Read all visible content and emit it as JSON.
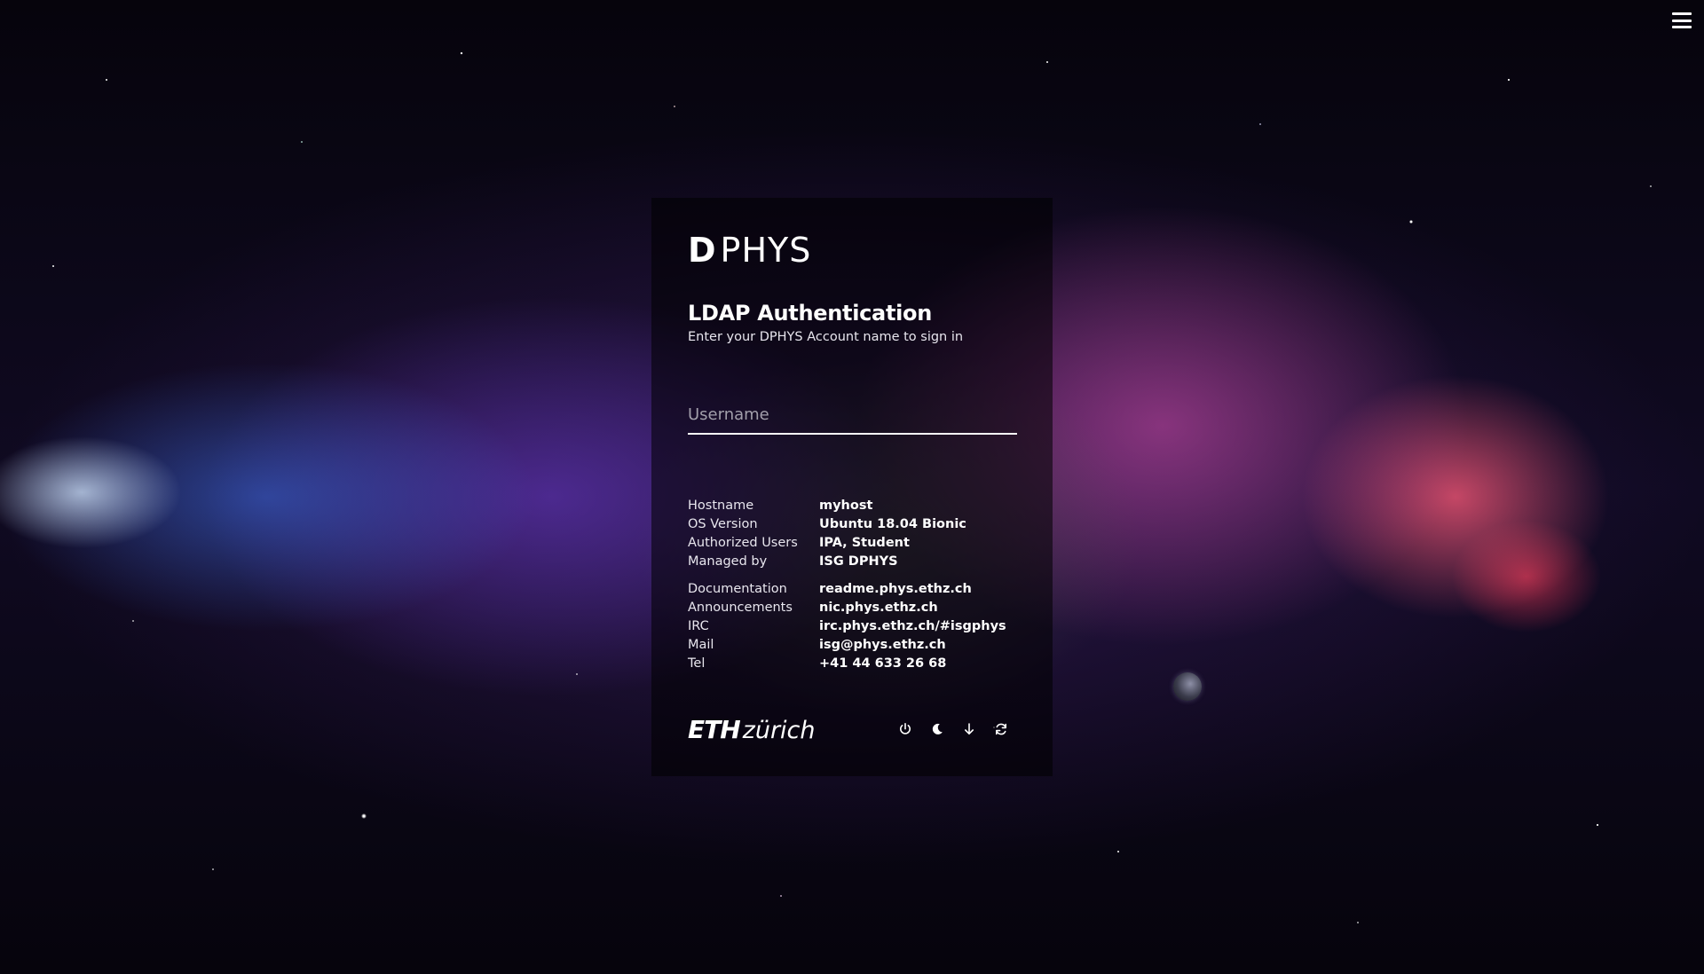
{
  "brand": {
    "logo_mark": "D",
    "logo_text": "PHYS"
  },
  "login": {
    "title": "LDAP Authentication",
    "subtitle": "Enter your DPHYS Account name to sign in",
    "username_value": "",
    "username_placeholder": "Username"
  },
  "system_info": [
    {
      "label": "Hostname",
      "value": "myhost"
    },
    {
      "label": "OS Version",
      "value": "Ubuntu 18.04 Bionic"
    },
    {
      "label": "Authorized Users",
      "value": "IPA, Student"
    },
    {
      "label": "Managed by",
      "value": "ISG DPHYS"
    }
  ],
  "contact_info": [
    {
      "label": "Documentation",
      "value": "readme.phys.ethz.ch"
    },
    {
      "label": "Announcements",
      "value": "nic.phys.ethz.ch"
    },
    {
      "label": "IRC",
      "value": "irc.phys.ethz.ch/#isgphys"
    },
    {
      "label": "Mail",
      "value": "isg@phys.ethz.ch"
    },
    {
      "label": "Tel",
      "value": "+41 44 633 26 68"
    }
  ],
  "footer": {
    "eth_strong": "ETH",
    "eth_light": "zürich"
  },
  "icons": {
    "menu": "hamburger-menu-icon",
    "shutdown": "power-icon",
    "suspend": "moon-icon",
    "hibernate": "arrow-down-icon",
    "restart": "refresh-icon"
  }
}
